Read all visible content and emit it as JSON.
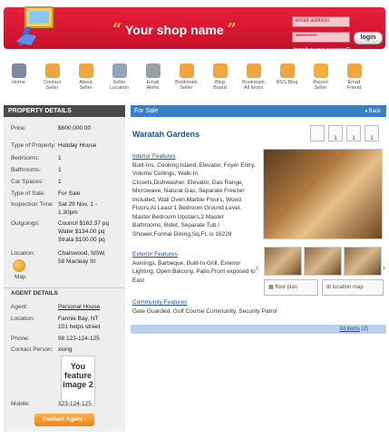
{
  "header": {
    "shop_name": "Your shop name",
    "open_quote": "“",
    "close_quote": "”",
    "email_placeholder": "email address",
    "password_value": "•••••••••••",
    "login_label": "login",
    "forgot_label": "forgotten your password?"
  },
  "nav": [
    {
      "label": "Home",
      "color": "#7a8aa0"
    },
    {
      "label": "Contact\nSeller",
      "color": "#f0a640"
    },
    {
      "label": "About\nSeller",
      "color": "#f0a640"
    },
    {
      "label": "Seller\nLocation",
      "color": "#8fa2b8"
    },
    {
      "label": "Email\nAlerts",
      "color": "#9aa0a8"
    },
    {
      "label": "Bookmark\nSeller",
      "color": "#f0a640"
    },
    {
      "label": "Blog\nBoard",
      "color": "#f0a640"
    },
    {
      "label": "Bookmark\nAll Items",
      "color": "#f0a640"
    },
    {
      "label": "RSS Blog",
      "color": "#f0a640"
    },
    {
      "label": "Report\nSeller",
      "color": "#f0b040"
    },
    {
      "label": "Email\nFriend",
      "color": "#f0a640"
    }
  ],
  "property": {
    "heading": "PROPERTY DETAILS",
    "price_label": "Price:",
    "price": "$600,000.00",
    "type_label": "Type of Property:",
    "type": "Holiday House",
    "bedrooms_label": "Bedrooms:",
    "bedrooms": "1",
    "bathrooms_label": "Bathrooms:",
    "bathrooms": "1",
    "car_label": "Car Spaces:",
    "car": "1",
    "sale_label": "Type of Sale:",
    "sale": "For Sale",
    "inspection_label": "Inspection Time:",
    "inspection1": "Sat 29 Nov, 1 -",
    "inspection2": "1.30pm",
    "outgoings_label": "Outgoings:",
    "out1": "Council $162.37 pq",
    "out2": "Water $134.00 pq",
    "out3": "Strata $100.00 pq",
    "location_label": "Location:",
    "loc1": "Chatswood, NSW,",
    "loc2": "58 Macleay St",
    "map_label": "Map"
  },
  "agent": {
    "heading": "AGENT DETAILS",
    "agent_label": "Agent:",
    "agent": "Personal House",
    "location_label": "Location:",
    "loc1": "Fannie Bay, NT",
    "loc2": "101 helps street",
    "phone_label": "Phone:",
    "phone": "98 123-124-125",
    "contact_label": "Contact Person:",
    "contact": "xiong",
    "feature_text": "You feature image 2",
    "mobile_label": "Mobile:",
    "mobile": "123-124-125",
    "contact_button": "Contact Agent ›"
  },
  "main": {
    "for_sale": "For Sale",
    "back": "◂ Back",
    "title": "Waratah Gardens",
    "amenities": [
      "",
      "1",
      "1",
      "1"
    ],
    "interior_title": "Interior Features",
    "interior_lines": [
      "Built-Ins, Cooking Island, Elevator, Foyer Entry,",
      "Volume Ceilings, Walk-In",
      "Closets,Dishwasher, Elevator, Gas Range,",
      "Microwave, Natural Gas, Separate Freezer",
      "Included, Wall Oven,Marble Floors, Wood",
      "Floors,At Least 1 Bedroom Ground Level,",
      "Master Bedroom Upstairs,2 Master",
      "Bathrooms, Bidet, Separate Tub /",
      "Shower,Formal Dining,Sq.Ft. is 16228"
    ],
    "exterior_title": "Exterior Features",
    "exterior_lines": [
      "Awnings, Barbeque, Built-In Grill, Exterior",
      "Lighting, Open Balcony, Patio,Front exposed to",
      "East"
    ],
    "community_title": "Community Features",
    "community_lines": [
      "Gate Guarded, Golf Course Community, Security Patrol"
    ],
    "floor_plan": "floor plan",
    "location_map": "location map",
    "all_items": "All items",
    "all_items_count": "(2)"
  }
}
